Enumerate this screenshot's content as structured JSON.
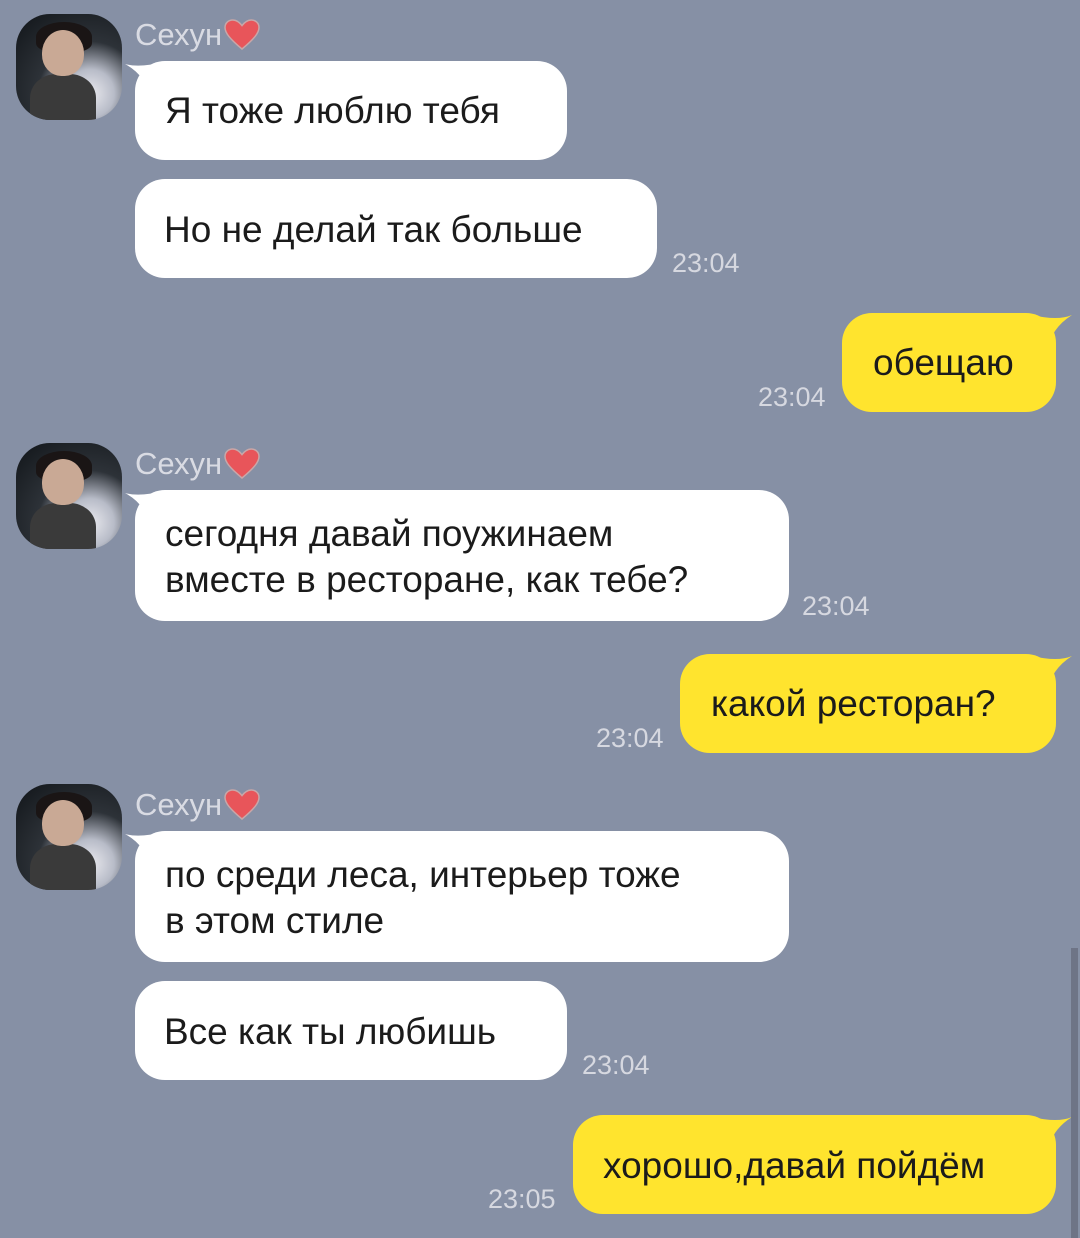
{
  "chat": {
    "sender_name": "Сехун",
    "messages": [
      {
        "text": "Я тоже люблю тебя"
      },
      {
        "text": "Но не делай так больше",
        "time": "23:04"
      },
      {
        "text": "обещаю",
        "time": "23:04"
      },
      {
        "text": "сегодня давай поужинаем",
        "text2": "вместе в ресторане, как тебе?",
        "time": "23:04"
      },
      {
        "text": "какой ресторан?",
        "time": "23:04"
      },
      {
        "text": "по среди леса, интерьер тоже",
        "text2": "в этом стиле"
      },
      {
        "text": "Все как ты любишь",
        "time": "23:04"
      },
      {
        "text": "хорошо,давай пойдём",
        "time": "23:05"
      }
    ]
  },
  "colors": {
    "background": "#8690a5",
    "incoming_bubble": "#ffffff",
    "outgoing_bubble": "#ffe42e",
    "heart": "#e8555a"
  },
  "icons": {
    "heart": "heart-icon"
  }
}
